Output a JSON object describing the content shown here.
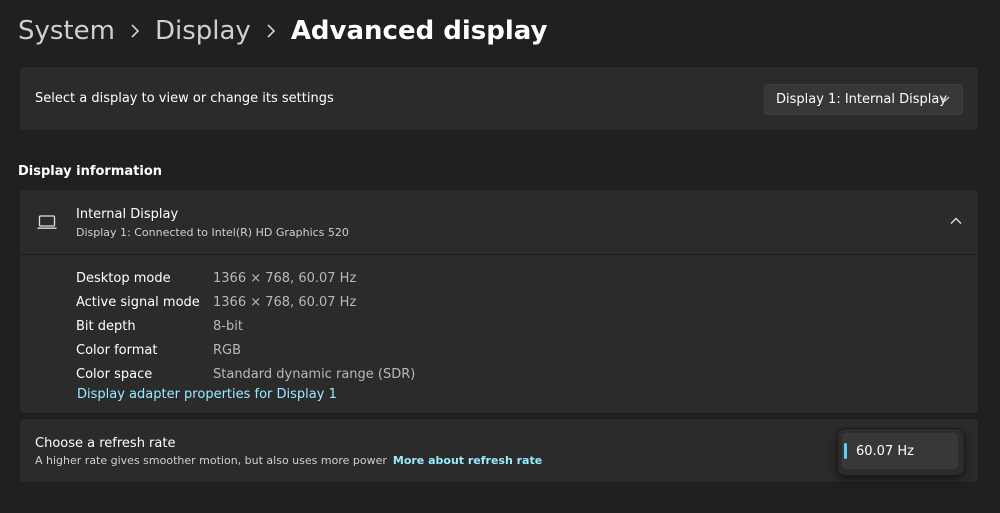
{
  "breadcrumb": {
    "items": [
      "System",
      "Display"
    ],
    "current": "Advanced display",
    "icons": {
      "separator": "chevron-right-icon"
    }
  },
  "display_select": {
    "label": "Select a display to view or change its settings",
    "value": "Display 1: Internal Display",
    "icon": "chevron-down-icon"
  },
  "display_info": {
    "section_title": "Display information",
    "title": "Internal Display",
    "subtitle": "Display 1: Connected to Intel(R) HD Graphics 520",
    "icon": "laptop-icon",
    "collapse_icon": "chevron-up-icon",
    "rows": [
      {
        "label": "Desktop mode",
        "value": "1366 × 768, 60.07 Hz"
      },
      {
        "label": "Active signal mode",
        "value": "1366 × 768, 60.07 Hz"
      },
      {
        "label": "Bit depth",
        "value": "8-bit"
      },
      {
        "label": "Color format",
        "value": "RGB"
      },
      {
        "label": "Color space",
        "value": "Standard dynamic range (SDR)"
      }
    ],
    "adapter_link": "Display adapter properties for Display 1"
  },
  "refresh_rate": {
    "title": "Choose a refresh rate",
    "description": "A higher rate gives smoother motion, but also uses more power",
    "link": "More about refresh rate",
    "selected": "60.07 Hz"
  },
  "colors": {
    "background": "#202020",
    "card": "#2b2b2b",
    "accent": "#60cdff",
    "link": "#99ebff"
  }
}
